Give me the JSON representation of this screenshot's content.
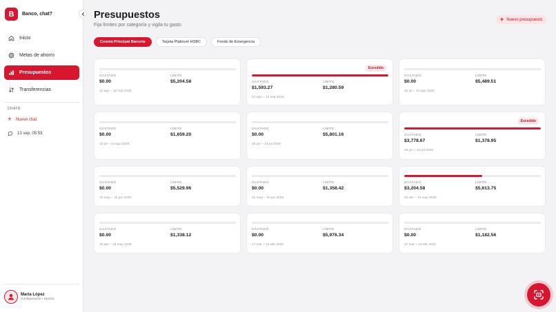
{
  "app": {
    "logo_letter": "B",
    "name": "Banco, chat?"
  },
  "sidebar": {
    "items": [
      {
        "label": "Inicio",
        "icon": "home-icon",
        "active": false
      },
      {
        "label": "Metas de ahorro",
        "icon": "target-icon",
        "active": false
      },
      {
        "label": "Presupuestos",
        "icon": "budget-icon",
        "active": true
      },
      {
        "label": "Transferencias",
        "icon": "transfer-icon",
        "active": false
      }
    ],
    "chats_label": "CHATS",
    "new_chat": "Nuevo chat",
    "chat_entry": "13 sep, 05:53",
    "user": {
      "name": "María López",
      "sub": "Configuración / Sesión"
    }
  },
  "header": {
    "title": "Presupuestos",
    "subtitle": "Fija límites por categoría y vigila tu gasto",
    "new_button": "Nuevo presupuesto"
  },
  "tabs": [
    "Cuenta Principal Banorte",
    "Tarjeta Platinum HSBC",
    "Fondo de Emergencia"
  ],
  "labels": {
    "spent": "GASTADO",
    "limit": "LÍMITE"
  },
  "cards": [
    {
      "spent": "$0.00",
      "limit": "$5,204.58",
      "dates": "14 ago – 13 sep 2026",
      "progress": 0,
      "badge": ""
    },
    {
      "spent": "$1,593.27",
      "limit": "$1,280.59",
      "dates": "14 ago – 13 sep 2026",
      "progress": 100,
      "badge": "Excedido"
    },
    {
      "spent": "$0.00",
      "limit": "$5,489.51",
      "dates": "15 jul – 14 ago 2026",
      "progress": 0,
      "badge": ""
    },
    {
      "spent": "$0.00",
      "limit": "$1,659.20",
      "dates": "15 jul – 14 ago 2026",
      "progress": 0,
      "badge": ""
    },
    {
      "spent": "$0.00",
      "limit": "$5,801.16",
      "dates": "15 jun – 15 jul 2026",
      "progress": 0,
      "badge": ""
    },
    {
      "spent": "$3,778.67",
      "limit": "$1,378.95",
      "dates": "15 jun – 15 jul 2026",
      "progress": 100,
      "badge": "Excedido"
    },
    {
      "spent": "$0.00",
      "limit": "$5,529.96",
      "dates": "16 may – 15 jun 2026",
      "progress": 0,
      "badge": ""
    },
    {
      "spent": "$0.00",
      "limit": "$1,358.42",
      "dates": "16 may – 15 jun 2026",
      "progress": 0,
      "badge": ""
    },
    {
      "spent": "$3,204.58",
      "limit": "$5,613.75",
      "dates": "16 abr – 16 may 2026",
      "progress": 57,
      "badge": ""
    },
    {
      "spent": "$0.00",
      "limit": "$1,338.12",
      "dates": "16 abr – 16 may 2026",
      "progress": 0,
      "badge": ""
    },
    {
      "spent": "$0.00",
      "limit": "$5,976.34",
      "dates": "17 mar – 16 abr 2026",
      "progress": 0,
      "badge": ""
    },
    {
      "spent": "$0.00",
      "limit": "$1,182.56",
      "dates": "17 mar – 16 abr 2026",
      "progress": 0,
      "badge": ""
    }
  ],
  "colors": {
    "accent": "#d7172f",
    "accent_soft": "#fbe3e6",
    "background": "#f3f3f5"
  }
}
